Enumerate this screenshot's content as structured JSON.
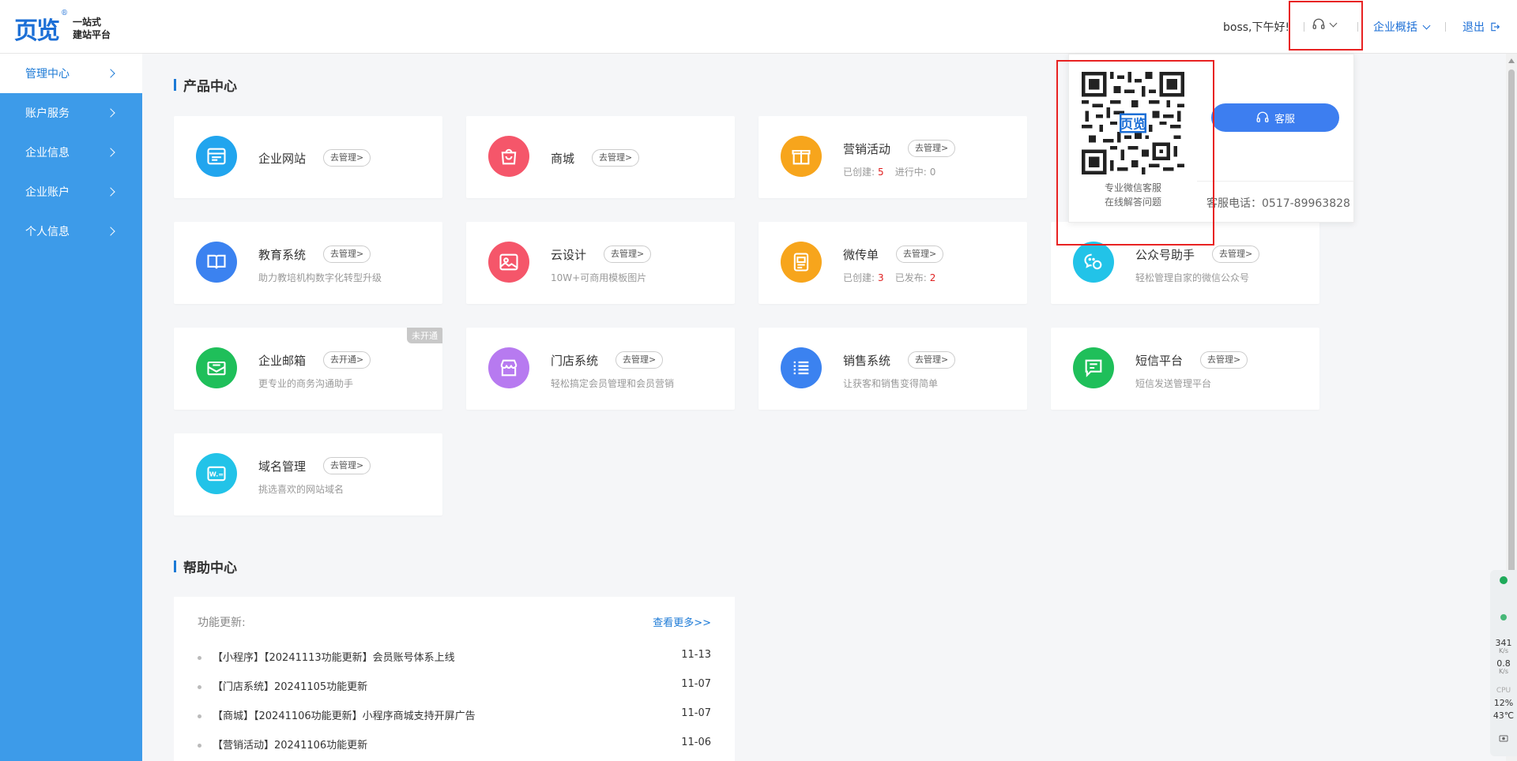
{
  "header": {
    "logo_mark": "页览",
    "logo_reg": "®",
    "logo_line1": "一站式",
    "logo_line2": "建站平台",
    "greeting": "boss,下午好!",
    "overview": "企业概括",
    "logout": "退出"
  },
  "sidebar": {
    "items": [
      {
        "label": "管理中心",
        "active": true
      },
      {
        "label": "账户服务"
      },
      {
        "label": "企业信息"
      },
      {
        "label": "企业账户"
      },
      {
        "label": "个人信息"
      }
    ]
  },
  "products": {
    "title": "产品中心",
    "cards": [
      {
        "name": "企业网站",
        "action": "去管理>",
        "color": "#21a5ee",
        "icon": "website-icon"
      },
      {
        "name": "商城",
        "action": "去管理>",
        "color": "#f5566a",
        "icon": "shopping-bag-icon"
      },
      {
        "name": "营销活动",
        "action": "去管理>",
        "color": "#f7a51c",
        "icon": "gift-icon",
        "stat1_label": "已创建:",
        "stat1_value": "5",
        "stat2_label": "进行中:",
        "stat2_value": "0"
      },
      {
        "name": "教育系统",
        "action": "去管理>",
        "color": "#3b82f0",
        "icon": "book-icon",
        "desc": "助力教培机构数字化转型升级"
      },
      {
        "name": "云设计",
        "action": "去管理>",
        "color": "#f5566a",
        "icon": "image-icon",
        "desc": "10W+可商用模板图片"
      },
      {
        "name": "微传单",
        "action": "去管理>",
        "color": "#f7a51c",
        "icon": "flyer-icon",
        "stat1_label": "已创建:",
        "stat1_value": "3",
        "stat2_label": "已发布:",
        "stat2_value": "2"
      },
      {
        "name": "公众号助手",
        "action": "去管理>",
        "color": "#22c3e8",
        "icon": "wechat-icon",
        "desc": "轻松管理自家的微信公众号"
      },
      {
        "name": "企业邮箱",
        "action": "去开通>",
        "color": "#1fbf5a",
        "icon": "mail-icon",
        "desc": "更专业的商务沟通助手",
        "badge": "未开通"
      },
      {
        "name": "门店系统",
        "action": "去管理>",
        "color": "#b77af0",
        "icon": "store-icon",
        "desc": "轻松搞定会员管理和会员营销"
      },
      {
        "name": "销售系统",
        "action": "去管理>",
        "color": "#3b82f0",
        "icon": "list-icon",
        "desc": "让获客和销售变得简单"
      },
      {
        "name": "短信平台",
        "action": "去管理>",
        "color": "#1fbf5a",
        "icon": "sms-icon",
        "desc": "短信发送管理平台"
      },
      {
        "name": "域名管理",
        "action": "去管理>",
        "color": "#22c3e8",
        "icon": "domain-icon",
        "desc": "挑选喜欢的网站域名"
      }
    ]
  },
  "help": {
    "title": "帮助中心",
    "label": "功能更新:",
    "more": "查看更多>>",
    "items": [
      {
        "text": "【小程序】【20241113功能更新】会员账号体系上线",
        "date": "11-13"
      },
      {
        "text": "【门店系统】20241105功能更新",
        "date": "11-07"
      },
      {
        "text": "【商城】【20241106功能更新】小程序商城支持开屏广告",
        "date": "11-07"
      },
      {
        "text": "【营销活动】20241106功能更新",
        "date": "11-06"
      }
    ]
  },
  "popup": {
    "qr_caption1": "专业微信客服",
    "qr_caption2": "在线解答问题",
    "qr_logo": "页览",
    "service_button": "客服",
    "phone": "客服电话：0517-89963828"
  },
  "widget": {
    "net1": "341",
    "net1_unit": "K/s",
    "net2": "0.8",
    "net2_unit": "K/s",
    "cpu_label": "CPU",
    "cpu": "12%",
    "temp": "43℃"
  },
  "colors": {
    "sidebar": "#3d9be9",
    "accent": "#1c7ad6",
    "highlight": "#e82222"
  }
}
